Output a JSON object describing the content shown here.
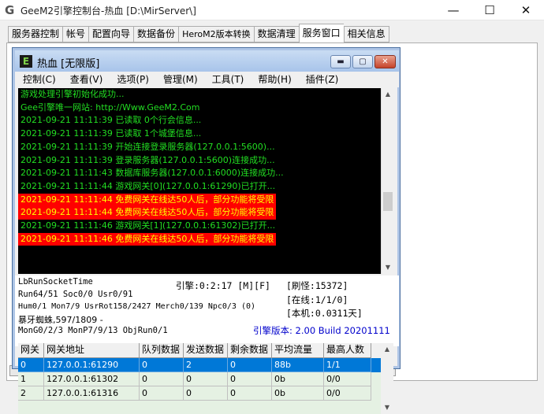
{
  "window": {
    "title": "GeeM2引擎控制台-热血 [D:\\MirServer\\]",
    "app_icon": "G",
    "minimize": "—",
    "maximize": "☐",
    "close": "✕"
  },
  "tabs": [
    {
      "label": "服务器控制"
    },
    {
      "label": "帐号"
    },
    {
      "label": "配置向导"
    },
    {
      "label": "数据备份"
    },
    {
      "label": "HeroM2版本转换"
    },
    {
      "label": "数据清理"
    },
    {
      "label": "服务窗口"
    },
    {
      "label": "相关信息"
    }
  ],
  "child": {
    "title": "热血 [无限版]",
    "icon": "E",
    "btn_min": "▬",
    "btn_max": "▢",
    "btn_close": "✕",
    "menu": [
      "控制(C)",
      "查看(V)",
      "选项(P)",
      "管理(M)",
      "工具(T)",
      "帮助(H)",
      "插件(Z)"
    ]
  },
  "log": [
    {
      "text": "游戏处理引擎初始化成功...",
      "warn": false
    },
    {
      "text": "Gee引擎唯一网站: http://Www.GeeM2.Com",
      "warn": false
    },
    {
      "text": "2021-09-21 11:11:39 已读取 0个行会信息...",
      "warn": false
    },
    {
      "text": "2021-09-21 11:11:39 已读取 1个城堡信息...",
      "warn": false
    },
    {
      "text": "2021-09-21 11:11:39 开始连接登录服务器(127.0.0.1:5600)...",
      "warn": false
    },
    {
      "text": "2021-09-21 11:11:39 登录服务器(127.0.0.1:5600)连接成功...",
      "warn": false
    },
    {
      "text": "2021-09-21 11:11:43 数据库服务器(127.0.0.1:6000)连接成功...",
      "warn": false
    },
    {
      "text": "2021-09-21 11:11:44 游戏网关[0](127.0.0.1:61290)已打开...",
      "warn": false
    },
    {
      "text": "2021-09-21 11:11:44 免费网关在线达50人后，部分功能将受限",
      "warn": true
    },
    {
      "text": "2021-09-21 11:11:44 免费网关在线达50人后，部分功能将受限",
      "warn": true
    },
    {
      "text": "2021-09-21 11:11:46 游戏网关[1](127.0.0.1:61302)已打开...",
      "warn": false
    },
    {
      "text": "2021-09-21 11:11:46 免费网关在线达50人后，部分功能将受限",
      "warn": true
    }
  ],
  "status": {
    "run_socket": "LbRunSocketTime",
    "engine_time": "引擎:0:2:17 [M][F]",
    "refresh": "[刷怪:15372]",
    "run": "Run64/51 Soc0/0 Usr0/91",
    "online": "[在线:1/1/0]",
    "hum": "Hum0/1 Mon7/9 UsrRot158/2427 Merch0/139 Npc0/3 (0)",
    "local": "[本机:0.0311天]",
    "monster": "暴牙蜘蛛,597/1809 -",
    "mon_gen": "MonG0/2/3 MonP7/9/13 ObjRun0/1",
    "version": "引擎版本: 2.00 Build 20201111"
  },
  "grid": {
    "columns": [
      "网关",
      "网关地址",
      "队列数据",
      "发送数据",
      "剩余数据",
      "平均流量",
      "最高人数"
    ],
    "rows": [
      [
        "0",
        "127.0.0.1:61290",
        "0",
        "2",
        "0",
        "88b",
        "1/1"
      ],
      [
        "1",
        "127.0.0.1:61302",
        "0",
        "0",
        "0",
        "0b",
        "0/0"
      ],
      [
        "2",
        "127.0.0.1:61316",
        "0",
        "0",
        "0",
        "0b",
        "0/0"
      ]
    ]
  }
}
